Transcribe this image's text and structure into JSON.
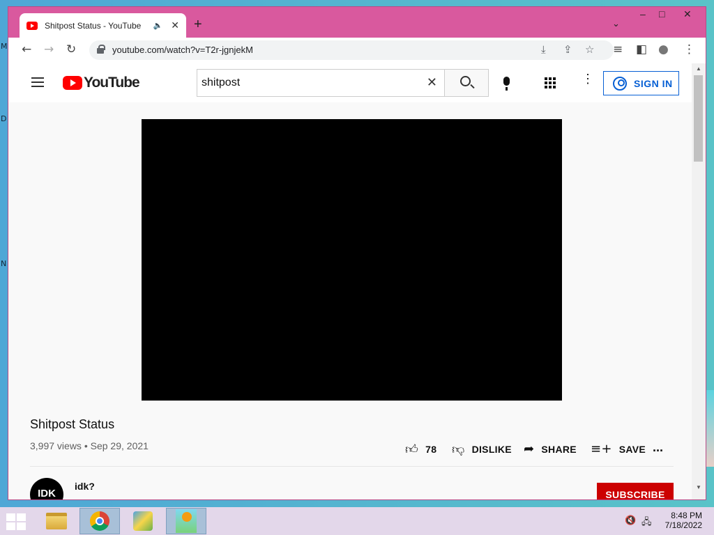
{
  "desktop": {
    "marks": [
      "M",
      "D",
      "N"
    ]
  },
  "browser": {
    "tab": {
      "title": "Shitpost Status - YouTube",
      "audio": "🔈",
      "close": "✕"
    },
    "new_tab": "+",
    "tab_menu": "⌄",
    "window_controls": {
      "minimize": "–",
      "maximize": "□",
      "close": "✕"
    },
    "nav": {
      "back": "←",
      "forward": "→",
      "reload": "↻"
    },
    "url": "youtube.com/watch?v=T2r-jgnjekM",
    "omni_icons": {
      "install": "⤓",
      "share": "⇪",
      "bookmark": "☆"
    },
    "toolbar_icons": {
      "media": "≡",
      "sidepanel": "◧",
      "profile": "●",
      "menu": "⋮"
    }
  },
  "youtube": {
    "logo_text": "YouTube",
    "search": {
      "value": "shitpost",
      "clear": "✕"
    },
    "menu_dots": "⋮",
    "sign_in": "SIGN IN",
    "video": {
      "title": "Shitpost Status",
      "views": "3,997 views",
      "separator": "•",
      "date": "Sep 29, 2021"
    },
    "actions": {
      "like_icon": "👍︎",
      "like_count": "78",
      "dislike_icon": "👎︎",
      "dislike": "DISLIKE",
      "share_icon": "➦",
      "share": "SHARE",
      "save_icon": "≡+",
      "save": "SAVE",
      "more": "..."
    },
    "channel": {
      "avatar_text": "IDK",
      "name": "idk?"
    },
    "subscribe": "SUBSCRIBE"
  },
  "scrollbar": {
    "up": "▲",
    "down": "▼"
  },
  "taskbar": {
    "tray": {
      "volume": "🔇",
      "network": "🖧"
    },
    "time": "8:48 PM",
    "date": "7/18/2022"
  }
}
